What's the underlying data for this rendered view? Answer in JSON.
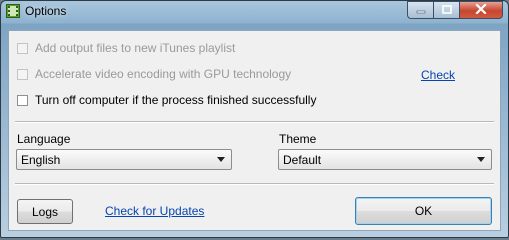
{
  "window": {
    "title": "Options",
    "icon": "app-film-icon",
    "controls": {
      "minimize": "minimize-icon",
      "maximize": "maximize-icon",
      "close": "close-icon"
    }
  },
  "options": {
    "itunes_label": "Add output files to new iTunes playlist",
    "gpu_label": "Accelerate video encoding with GPU technology",
    "gpu_check_link": "Check",
    "shutdown_label": "Turn off computer if the process finished successfully"
  },
  "language": {
    "label": "Language",
    "selected": "English"
  },
  "theme": {
    "label": "Theme",
    "selected": "Default"
  },
  "footer": {
    "logs_label": "Logs",
    "updates_link": "Check for Updates",
    "ok_label": "OK"
  },
  "colors": {
    "link": "#0645ad",
    "close_button": "#c5462f",
    "title_bar": "#8eb2cf"
  }
}
